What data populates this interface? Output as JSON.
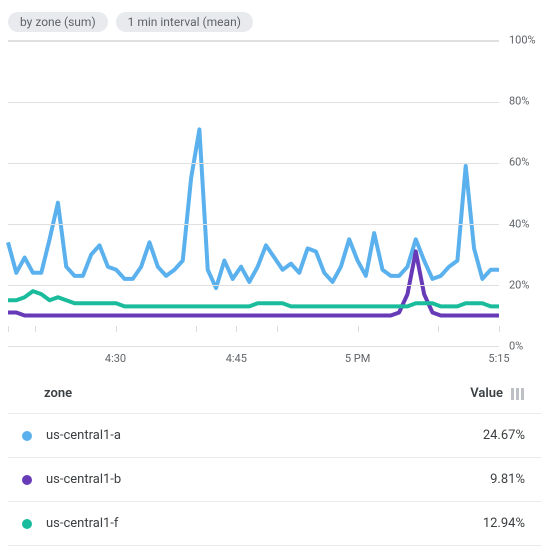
{
  "chips": {
    "chip1": "by zone (sum)",
    "chip2": "1 min interval (mean)"
  },
  "chart_data": {
    "type": "line",
    "ylim": [
      0,
      100
    ],
    "y_ticks": [
      0,
      20,
      40,
      60,
      80,
      100
    ],
    "y_unit": "%",
    "x_labels": [
      "4:30",
      "4:45",
      "5 PM",
      "5:15"
    ],
    "x_label_positions": [
      21.9,
      46.5,
      71.2,
      100
    ],
    "x_tick_positions": [
      0,
      5.48,
      21.9,
      38.3,
      46.5,
      54.8,
      71.2,
      87.6,
      100
    ],
    "x": [
      "4:16",
      "4:17",
      "4:18",
      "4:19",
      "4:20",
      "4:21",
      "4:22",
      "4:23",
      "4:24",
      "4:25",
      "4:26",
      "4:27",
      "4:28",
      "4:29",
      "4:30",
      "4:31",
      "4:32",
      "4:33",
      "4:34",
      "4:35",
      "4:36",
      "4:37",
      "4:38",
      "4:39",
      "4:40",
      "4:41",
      "4:42",
      "4:43",
      "4:44",
      "4:45",
      "4:46",
      "4:47",
      "4:48",
      "4:49",
      "4:50",
      "4:51",
      "4:52",
      "4:53",
      "4:54",
      "4:55",
      "4:56",
      "4:57",
      "4:58",
      "4:59",
      "5:00",
      "5:01",
      "5:02",
      "5:03",
      "5:04",
      "5:05",
      "5:06",
      "5:07",
      "5:08",
      "5:09",
      "5:10",
      "5:11",
      "5:12",
      "5:13",
      "5:14",
      "5:15"
    ],
    "series": [
      {
        "name": "us-central1-a",
        "color": "#5bb1ed",
        "current": "24.67%",
        "values": [
          34,
          24,
          29,
          24,
          24,
          35,
          47,
          26,
          23,
          23,
          30,
          33,
          26,
          25,
          22,
          22,
          26,
          34,
          26,
          23,
          25,
          28,
          55,
          71,
          25,
          19,
          28,
          22,
          26,
          21,
          26,
          33,
          29,
          25,
          27,
          24,
          32,
          31,
          24,
          21,
          26,
          35,
          28,
          23,
          37,
          25,
          23,
          23,
          26,
          35,
          28,
          22,
          23,
          26,
          28,
          59,
          32,
          22,
          25,
          25
        ]
      },
      {
        "name": "us-central1-b",
        "color": "#673ab7",
        "current": "9.81%",
        "values": [
          11,
          11,
          10,
          10,
          10,
          10,
          10,
          10,
          10,
          10,
          10,
          10,
          10,
          10,
          10,
          10,
          10,
          10,
          10,
          10,
          10,
          10,
          10,
          10,
          10,
          10,
          10,
          10,
          10,
          10,
          10,
          10,
          10,
          10,
          10,
          10,
          10,
          10,
          10,
          10,
          10,
          10,
          10,
          10,
          10,
          10,
          10,
          11,
          17,
          31,
          17,
          11,
          10,
          10,
          10,
          10,
          10,
          10,
          10,
          10
        ]
      },
      {
        "name": "us-central1-f",
        "color": "#1abc9c",
        "current": "12.94%",
        "values": [
          15,
          15,
          16,
          18,
          17,
          15,
          16,
          15,
          14,
          14,
          14,
          14,
          14,
          14,
          13,
          13,
          13,
          13,
          13,
          13,
          13,
          13,
          13,
          13,
          13,
          13,
          13,
          13,
          13,
          13,
          14,
          14,
          14,
          14,
          13,
          13,
          13,
          13,
          13,
          13,
          13,
          13,
          13,
          13,
          13,
          13,
          13,
          13,
          13,
          14,
          14,
          14,
          13,
          13,
          13,
          14,
          14,
          14,
          13,
          13
        ]
      }
    ]
  },
  "legend_header": {
    "zone": "zone",
    "value": "Value"
  }
}
